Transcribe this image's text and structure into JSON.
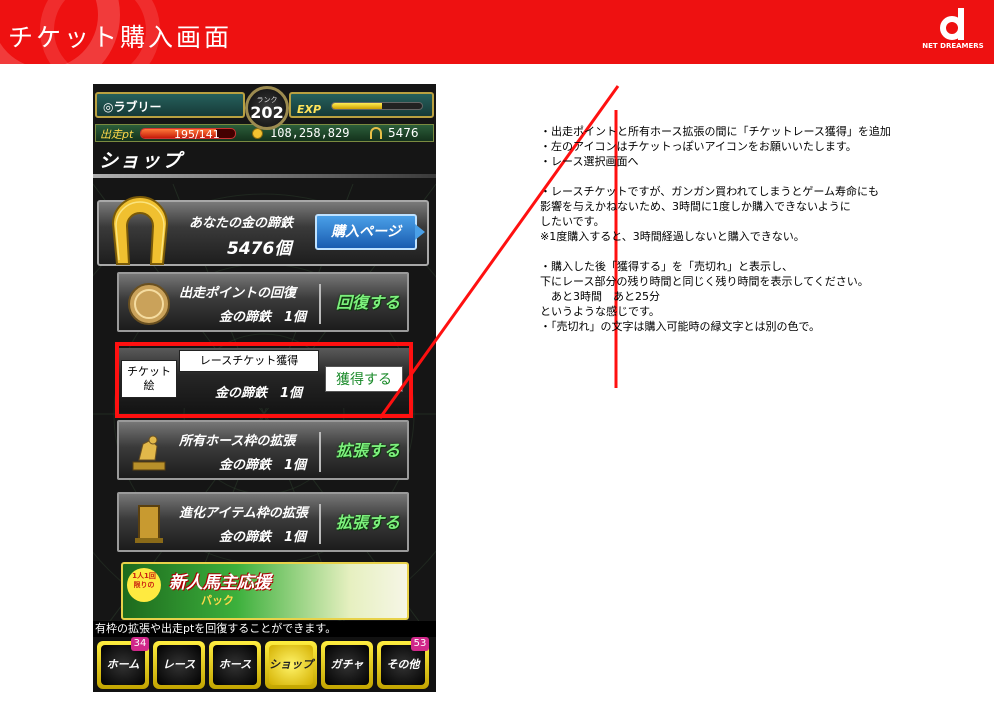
{
  "slide": {
    "title": "チケット購入画面",
    "brand_text": "NET DREAMERS"
  },
  "colors": {
    "header_red": "#ee1111",
    "annotation_red": "#ff1010",
    "action_green": "#7cf07c",
    "buy_blue": "#1a5cb0",
    "badge_magenta": "#d0288a"
  },
  "phone": {
    "user_name": "◎ラブリー",
    "rank": {
      "label": "ランク",
      "value": "202"
    },
    "exp": {
      "label": "EXP",
      "fill_fraction": 0.55
    },
    "pt": {
      "label": "出走pt",
      "value": "195/141",
      "fill_fraction": 0.8
    },
    "money": "108,258,829",
    "horseshoe_count": "5476",
    "screen_title": "ショップ",
    "gold_panel": {
      "label": "あなたの金の蹄鉄",
      "count": "5476個",
      "button": "購入ページ"
    },
    "items": [
      {
        "name": "出走ポイントの回復",
        "cost": "金の蹄鉄　1個",
        "action": "回復する",
        "icon": "horseshoe-pt-icon"
      },
      {
        "name": "所有ホース枠の拡張",
        "cost": "金の蹄鉄　1個",
        "action": "拡張する",
        "icon": "horse-trophy-icon"
      },
      {
        "name": "進化アイテム枠の拡張",
        "cost": "金の蹄鉄　1個",
        "action": "拡張する",
        "icon": "item-box-icon"
      }
    ],
    "ticket_row": {
      "picture_label": "チケット\n絵",
      "title": "レースチケット獲得",
      "cost": "金の蹄鉄　1個",
      "button": "獲得する"
    },
    "banner": {
      "badge": "1人1回\n限りの",
      "title": "新人馬主応援",
      "subtitle": "パック"
    },
    "ticker": "有枠の拡張や出走ptを回復することができます。",
    "nav": [
      {
        "label": "ホーム",
        "badge": "34"
      },
      {
        "label": "レース",
        "badge": ""
      },
      {
        "label": "ホース",
        "badge": ""
      },
      {
        "label": "ショップ",
        "badge": "",
        "active": true
      },
      {
        "label": "ガチャ",
        "badge": ""
      },
      {
        "label": "その他",
        "badge": "53"
      }
    ]
  },
  "notes": [
    "・出走ポイントと所有ホース拡張の間に「チケットレース獲得」を追加",
    "・左のアイコンはチケットっぽいアイコンをお願いいたします。",
    "・レース選択画面へ",
    "",
    "・レースチケットですが、ガンガン買われてしまうとゲーム寿命にも",
    "影響を与えかねないため、3時間に1度しか購入できないように",
    "したいです。",
    "※1度購入すると、3時間経過しないと購入できない。",
    "",
    "・購入した後「獲得する」を「売切れ」と表示し、",
    "下にレース部分の残り時間と同じく残り時間を表示してください。",
    "　あと3時間　あと25分",
    "というような感じです。",
    "・「売切れ」の文字は購入可能時の緑文字とは別の色で。"
  ]
}
